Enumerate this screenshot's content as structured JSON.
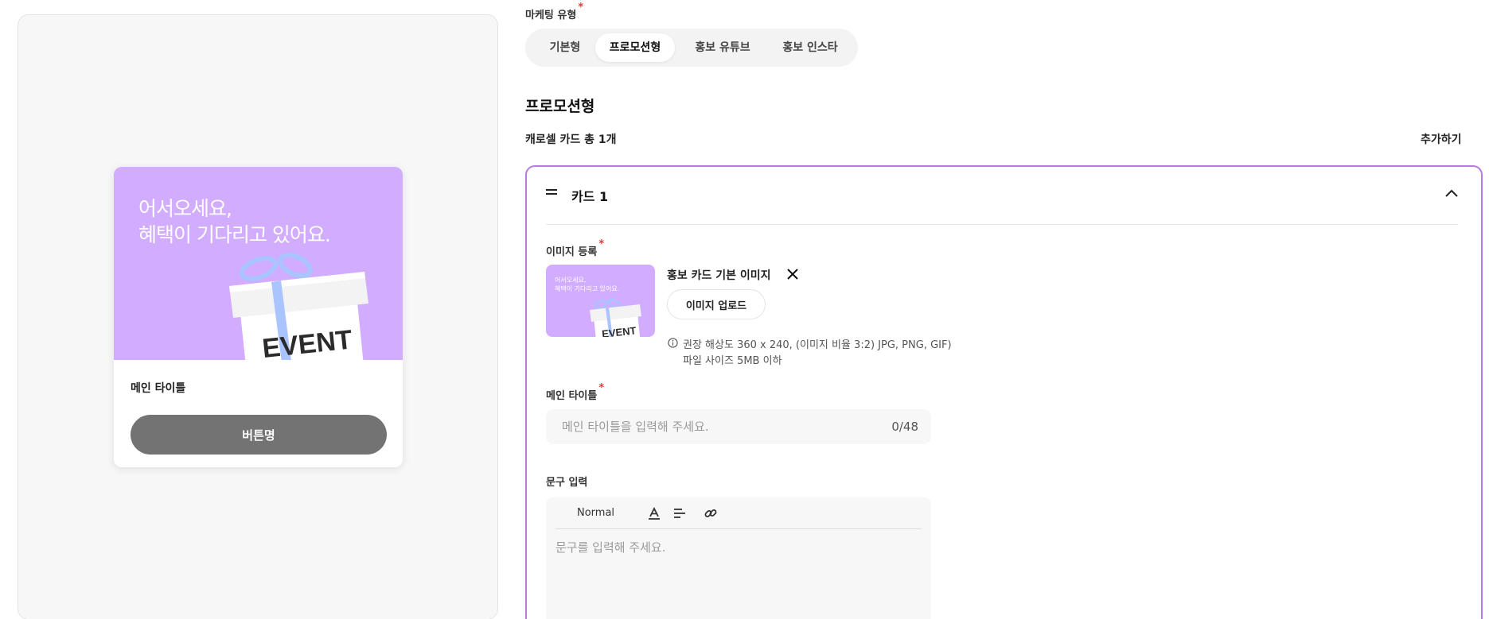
{
  "preview": {
    "banner_text": "어서오세요,\n혜택이 기다리고 있어요.",
    "gift_label": "EVENT",
    "title": "메인 타이틀",
    "button_label": "버튼명",
    "banner_color": "#d1acff"
  },
  "form": {
    "marketing_type_label": "마케팅 유형",
    "marketing_types": [
      {
        "label": "기본형",
        "active": false
      },
      {
        "label": "프로모션형",
        "active": true
      },
      {
        "label": "홍보 유튜브",
        "active": false
      },
      {
        "label": "홍보 인스타",
        "active": false
      }
    ],
    "section_title": "프로모션형",
    "carousel_count": "캐로셀 카드 총 1개",
    "add_label": "추가하기",
    "required_mark": "*",
    "accent_color": "#b57be0"
  },
  "card": {
    "title": "카드 1",
    "image": {
      "label": "이미지 등록",
      "thumb_text": "어서오세요,\n혜택이 기다리고 있어요.",
      "thumb_gift_label": "EVENT",
      "name": "홍보 카드 기본 이미지",
      "upload_label": "이미지 업로드",
      "hint_line1": "권장 해상도 360 x 240, (이미지 비율 3:2) JPG, PNG, GIF)",
      "hint_line2": "파일 사이즈 5MB 이하"
    },
    "main_title": {
      "label": "메인 타이틀",
      "placeholder": "메인 타이틀을 입력해 주세요.",
      "value": "",
      "counter": "0/48"
    },
    "text": {
      "label": "문구 입력",
      "format_label": "Normal",
      "placeholder": "문구를 입력해 주세요."
    }
  }
}
